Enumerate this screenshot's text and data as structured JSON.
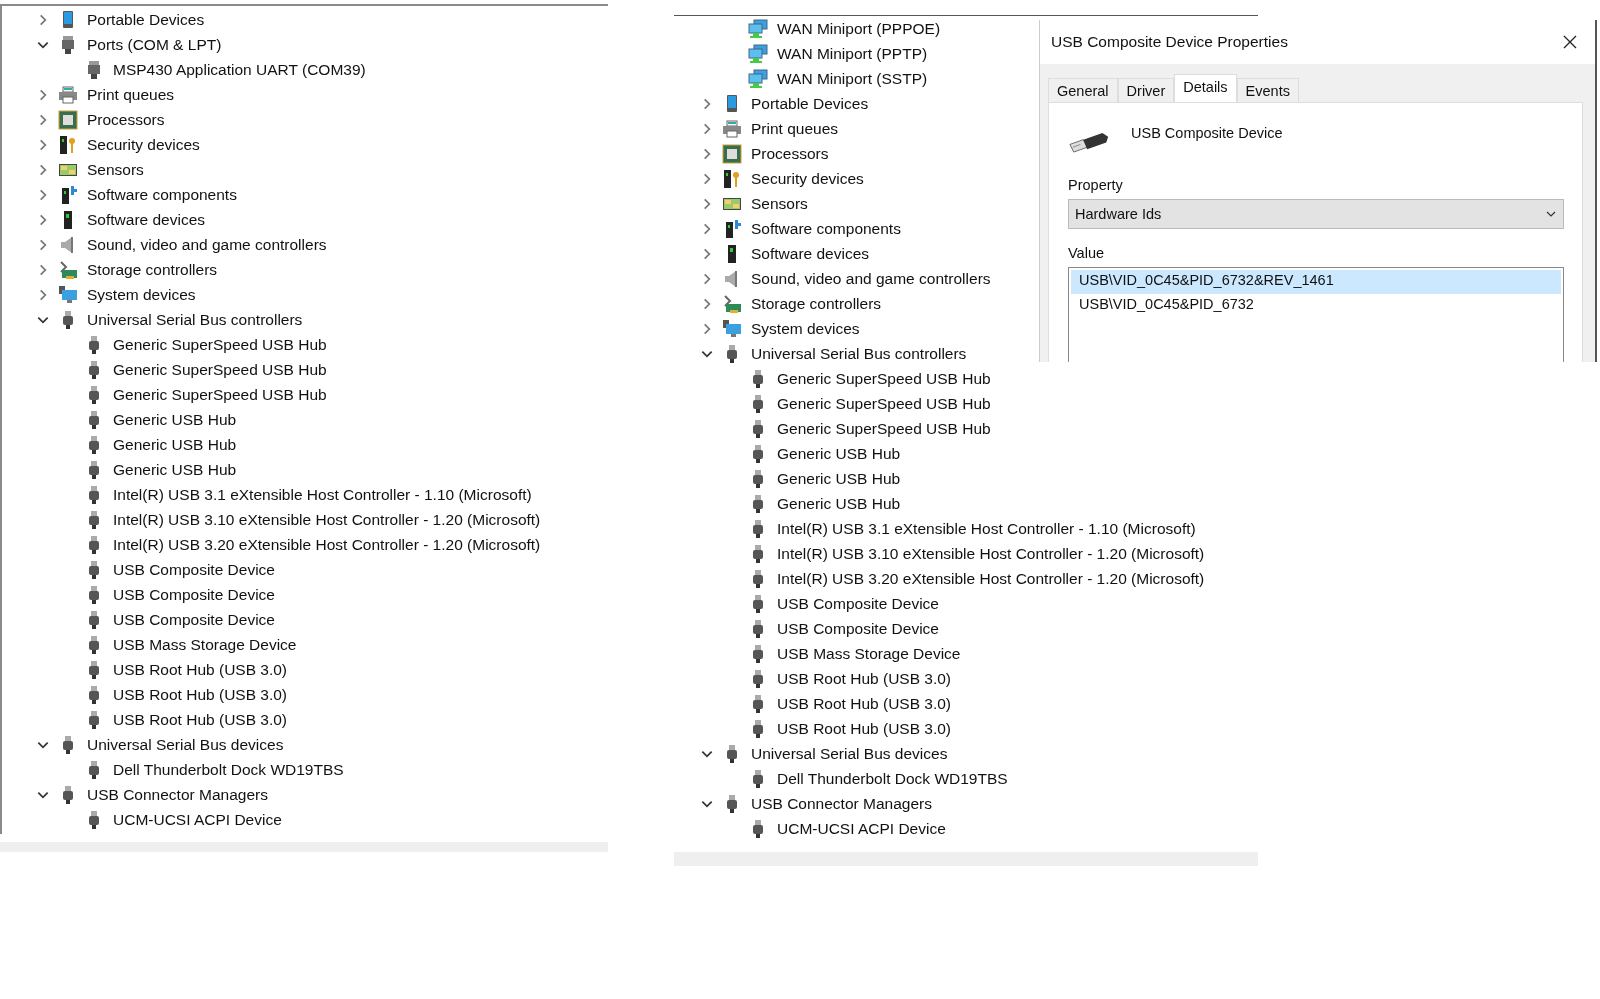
{
  "device_trees": [
    {
      "items": [
        {
          "label": "Portable Devices",
          "kind": "portable",
          "expanded": false
        },
        {
          "label": "Ports (COM & LPT)",
          "kind": "port",
          "expanded": true,
          "children": [
            {
              "label": "MSP430 Application UART (COM39)",
              "kind": "port"
            }
          ]
        },
        {
          "label": "Print queues",
          "kind": "printer",
          "expanded": false
        },
        {
          "label": "Processors",
          "kind": "processor",
          "expanded": false
        },
        {
          "label": "Security devices",
          "kind": "security",
          "expanded": false
        },
        {
          "label": "Sensors",
          "kind": "sensor",
          "expanded": false
        },
        {
          "label": "Software components",
          "kind": "softcomp",
          "expanded": false
        },
        {
          "label": "Software devices",
          "kind": "softdev",
          "expanded": false
        },
        {
          "label": "Sound, video and game controllers",
          "kind": "sound",
          "expanded": false
        },
        {
          "label": "Storage controllers",
          "kind": "storage",
          "expanded": false
        },
        {
          "label": "System devices",
          "kind": "system",
          "expanded": false
        },
        {
          "label": "Universal Serial Bus controllers",
          "kind": "usb",
          "expanded": true,
          "children": [
            {
              "label": "Generic SuperSpeed USB Hub",
              "kind": "usb"
            },
            {
              "label": "Generic SuperSpeed USB Hub",
              "kind": "usb"
            },
            {
              "label": "Generic SuperSpeed USB Hub",
              "kind": "usb"
            },
            {
              "label": "Generic USB Hub",
              "kind": "usb"
            },
            {
              "label": "Generic USB Hub",
              "kind": "usb"
            },
            {
              "label": "Generic USB Hub",
              "kind": "usb"
            },
            {
              "label": "Intel(R) USB 3.1 eXtensible Host Controller - 1.10 (Microsoft)",
              "kind": "usb"
            },
            {
              "label": "Intel(R) USB 3.10 eXtensible Host Controller - 1.20 (Microsoft)",
              "kind": "usb"
            },
            {
              "label": "Intel(R) USB 3.20 eXtensible Host Controller - 1.20 (Microsoft)",
              "kind": "usb"
            },
            {
              "label": "USB Composite Device",
              "kind": "usb"
            },
            {
              "label": "USB Composite Device",
              "kind": "usb"
            },
            {
              "label": "USB Composite Device",
              "kind": "usb"
            },
            {
              "label": "USB Mass Storage Device",
              "kind": "usb"
            },
            {
              "label": "USB Root Hub (USB 3.0)",
              "kind": "usb"
            },
            {
              "label": "USB Root Hub (USB 3.0)",
              "kind": "usb"
            },
            {
              "label": "USB Root Hub (USB 3.0)",
              "kind": "usb"
            }
          ]
        },
        {
          "label": "Universal Serial Bus devices",
          "kind": "usb",
          "expanded": true,
          "children": [
            {
              "label": "Dell Thunderbolt Dock WD19TBS",
              "kind": "usb"
            }
          ]
        },
        {
          "label": "USB Connector Managers",
          "kind": "usb",
          "expanded": true,
          "children": [
            {
              "label": "UCM-UCSI ACPI Device",
              "kind": "usb"
            }
          ]
        }
      ]
    },
    {
      "items": [
        {
          "children": [
            {
              "label": "WAN Miniport (PPPOE)",
              "kind": "network"
            },
            {
              "label": "WAN Miniport (PPTP)",
              "kind": "network"
            },
            {
              "label": "WAN Miniport (SSTP)",
              "kind": "network"
            }
          ]
        },
        {
          "label": "Portable Devices",
          "kind": "portable",
          "expanded": false
        },
        {
          "label": "Print queues",
          "kind": "printer",
          "expanded": false
        },
        {
          "label": "Processors",
          "kind": "processor",
          "expanded": false
        },
        {
          "label": "Security devices",
          "kind": "security",
          "expanded": false
        },
        {
          "label": "Sensors",
          "kind": "sensor",
          "expanded": false
        },
        {
          "label": "Software components",
          "kind": "softcomp",
          "expanded": false
        },
        {
          "label": "Software devices",
          "kind": "softdev",
          "expanded": false
        },
        {
          "label": "Sound, video and game controllers",
          "kind": "sound",
          "expanded": false
        },
        {
          "label": "Storage controllers",
          "kind": "storage",
          "expanded": false
        },
        {
          "label": "System devices",
          "kind": "system",
          "expanded": false
        },
        {
          "label": "Universal Serial Bus controllers",
          "kind": "usb",
          "expanded": true,
          "children": [
            {
              "label": "Generic SuperSpeed USB Hub",
              "kind": "usb"
            },
            {
              "label": "Generic SuperSpeed USB Hub",
              "kind": "usb"
            },
            {
              "label": "Generic SuperSpeed USB Hub",
              "kind": "usb"
            },
            {
              "label": "Generic USB Hub",
              "kind": "usb"
            },
            {
              "label": "Generic USB Hub",
              "kind": "usb"
            },
            {
              "label": "Generic USB Hub",
              "kind": "usb"
            },
            {
              "label": "Intel(R) USB 3.1 eXtensible Host Controller - 1.10 (Microsoft)",
              "kind": "usb"
            },
            {
              "label": "Intel(R) USB 3.10 eXtensible Host Controller - 1.20 (Microsoft)",
              "kind": "usb"
            },
            {
              "label": "Intel(R) USB 3.20 eXtensible Host Controller - 1.20 (Microsoft)",
              "kind": "usb"
            },
            {
              "label": "USB Composite Device",
              "kind": "usb"
            },
            {
              "label": "USB Composite Device",
              "kind": "usb"
            },
            {
              "label": "USB Mass Storage Device",
              "kind": "usb"
            },
            {
              "label": "USB Root Hub (USB 3.0)",
              "kind": "usb"
            },
            {
              "label": "USB Root Hub (USB 3.0)",
              "kind": "usb"
            },
            {
              "label": "USB Root Hub (USB 3.0)",
              "kind": "usb"
            }
          ]
        },
        {
          "label": "Universal Serial Bus devices",
          "kind": "usb",
          "expanded": true,
          "children": [
            {
              "label": "Dell Thunderbolt Dock WD19TBS",
              "kind": "usb"
            }
          ]
        },
        {
          "label": "USB Connector Managers",
          "kind": "usb",
          "expanded": true,
          "children": [
            {
              "label": "UCM-UCSI ACPI Device",
              "kind": "usb"
            }
          ]
        }
      ]
    }
  ],
  "properties_dialog": {
    "title": "USB Composite Device Properties",
    "tabs": [
      {
        "label": "General",
        "selected": false
      },
      {
        "label": "Driver",
        "selected": false
      },
      {
        "label": "Details",
        "selected": true
      },
      {
        "label": "Events",
        "selected": false
      }
    ],
    "device_name": "USB Composite Device",
    "property_label": "Property",
    "property_value": "Hardware Ids",
    "value_label": "Value",
    "values": [
      {
        "text": "USB\\VID_0C45&PID_6732&REV_1461",
        "selected": true
      },
      {
        "text": "USB\\VID_0C45&PID_6732",
        "selected": false
      }
    ]
  }
}
